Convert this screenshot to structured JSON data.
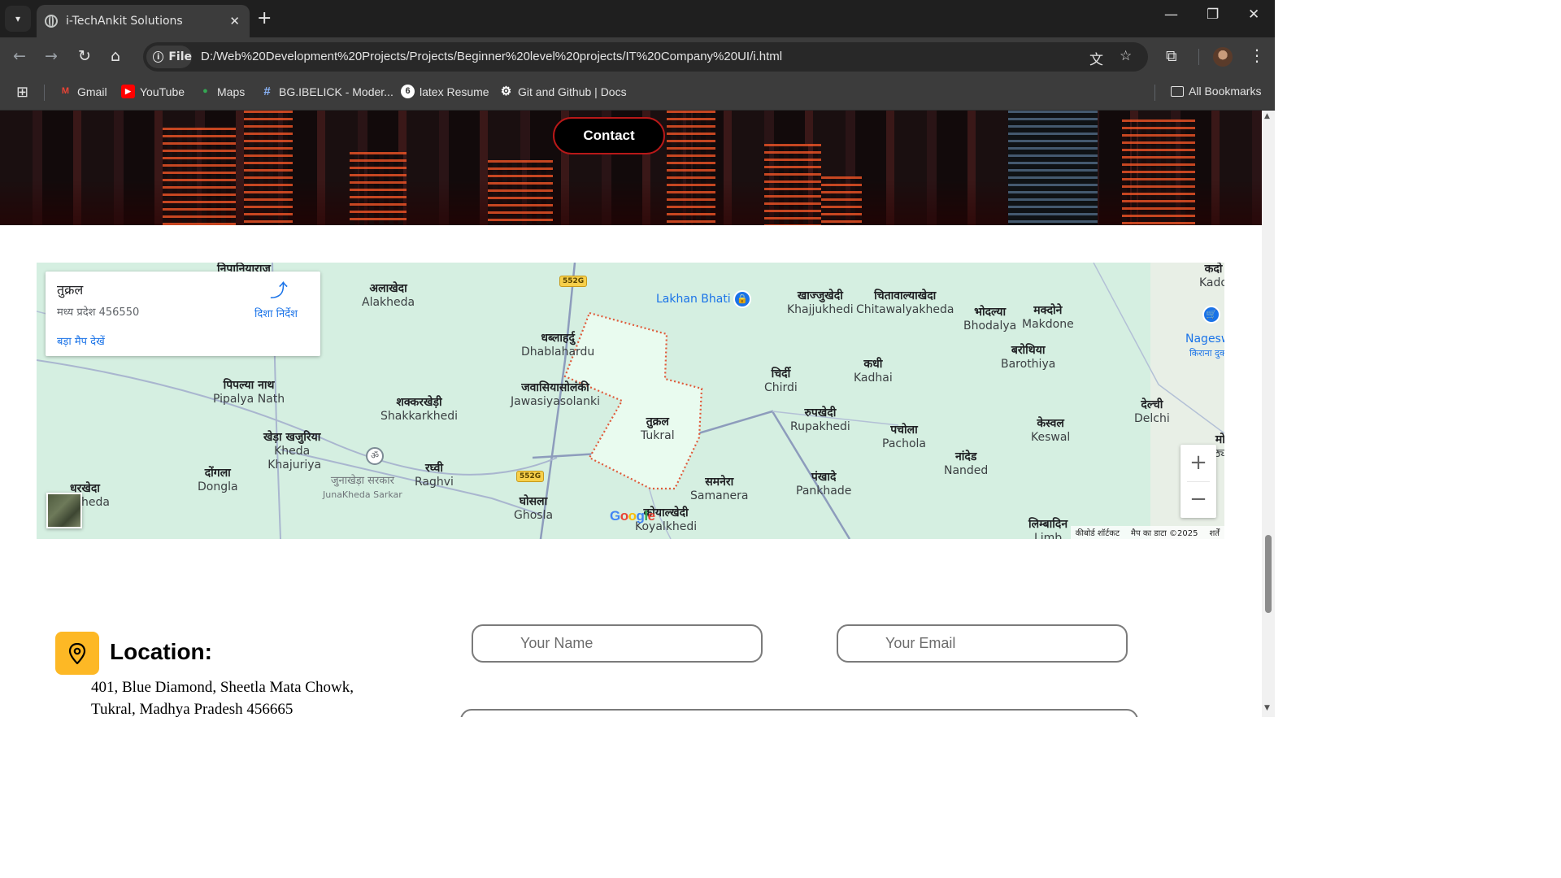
{
  "browser": {
    "tab_title": "i-TechAnkit Solutions",
    "close_tab": "✕",
    "new_tab": "+",
    "chip_label": "File",
    "url": "D:/Web%20Development%20Projects/Projects/Beginner%20level%20projects/IT%20Company%20UI/i.html",
    "bookmarks": [
      {
        "label": "Gmail",
        "icon": "gmail-icon",
        "color": "#ea4335"
      },
      {
        "label": "YouTube",
        "icon": "youtube-icon",
        "color": "#ff0000"
      },
      {
        "label": "Maps",
        "icon": "maps-icon",
        "color": "#34a853"
      },
      {
        "label": "BG.IBELICK - Moder...",
        "icon": "hash-icon",
        "color": "#8ab4f8"
      },
      {
        "label": "latex Resume",
        "icon": "overleaf-icon",
        "color": "#ffffff"
      },
      {
        "label": "Git and Github | Docs",
        "icon": "gear-icon",
        "color": "#ffffff"
      }
    ],
    "all_bookmarks": "All Bookmarks"
  },
  "hero": {
    "contact_button": "Contact"
  },
  "map": {
    "card": {
      "title": "तुक्रल",
      "subtitle": "मध्य प्रदेश 456550",
      "larger_map_link": "बड़ा मैप देखें",
      "directions": "दिशा निर्देश"
    },
    "route_badges": [
      "552G",
      "552G"
    ],
    "places": [
      {
        "hi": "निपानियाराज",
        "en": ""
      },
      {
        "hi": "अलाखेदा",
        "en": "Alakheda"
      },
      {
        "hi": "",
        "en": "Lakhan Bhati"
      },
      {
        "hi": "खाज्जुखेदी",
        "en": "Khajjukhedi"
      },
      {
        "hi": "चितावाल्याखेदा",
        "en": "Chitawalyakheda"
      },
      {
        "hi": "भोदल्या",
        "en": "Bhodalya"
      },
      {
        "hi": "मक्दोने",
        "en": "Makdone"
      },
      {
        "hi": "कदो",
        "en": "Kado"
      },
      {
        "hi": "",
        "en": "Nagesw"
      },
      {
        "hi": "किराना दुक",
        "en": ""
      },
      {
        "hi": "धब्लाहर्दु",
        "en": "Dhablahardu"
      },
      {
        "hi": "बरोथिया",
        "en": "Barothiya"
      },
      {
        "hi": "पिपल्या नाथ",
        "en": "Pipalya Nath"
      },
      {
        "hi": "जवासियासोलंकी",
        "en": "Jawasiyasolanki"
      },
      {
        "hi": "चिर्दी",
        "en": "Chirdi"
      },
      {
        "hi": "कधी",
        "en": "Kadhai"
      },
      {
        "hi": "शक्करखेड़ी",
        "en": "Shakkarkhedi"
      },
      {
        "hi": "तुक्रल",
        "en": "Tukral"
      },
      {
        "hi": "रुपखेदी",
        "en": "Rupakhedi"
      },
      {
        "hi": "पचोला",
        "en": "Pachola"
      },
      {
        "hi": "केस्वल",
        "en": "Keswal"
      },
      {
        "hi": "देल्ची",
        "en": "Delchi"
      },
      {
        "hi": "खेड़ा खजुरिया",
        "en": "Kheda Khajuriya"
      },
      {
        "hi": "नांदेड",
        "en": "Nanded"
      },
      {
        "hi": "दोंगला",
        "en": "Dongla"
      },
      {
        "hi": "रघ्वी",
        "en": "Raghvi"
      },
      {
        "hi": "जुनाखेड़ा सरकार",
        "en": "JunaKheda Sarkar"
      },
      {
        "hi": "धरखेदा",
        "en": "heda"
      },
      {
        "hi": "समनेरा",
        "en": "Samanera"
      },
      {
        "hi": "पंखादे",
        "en": "Pankhade"
      },
      {
        "hi": "घोसला",
        "en": "Ghosla"
      },
      {
        "hi": "कोयाल्खेदी",
        "en": "Koyalkhedi"
      },
      {
        "hi": "लिम्बादिन",
        "en": "Limb"
      },
      {
        "hi": "मो",
        "en": "ठ्य"
      }
    ],
    "google_logo": "Google",
    "attribution": [
      "कीबोर्ड शॉर्टकट",
      "मैप का डाटा ©2025",
      "शर्तें"
    ],
    "zoom_in": "+",
    "zoom_out": "−"
  },
  "location": {
    "title": "Location:",
    "address_line1": "401, Blue Diamond, Sheetla Mata Chowk,",
    "address_line2": "Tukral, Madhya Pradesh 456665"
  },
  "form": {
    "name_placeholder": "Your Name",
    "email_placeholder": "Your Email"
  }
}
